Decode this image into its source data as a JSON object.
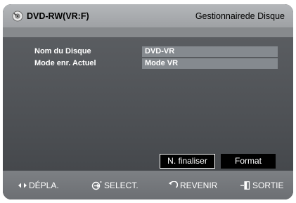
{
  "header": {
    "disc_label": "DVD-RW(VR:F)",
    "title": "Gestionnairede Disque",
    "disc_icon": "disc-icon"
  },
  "info": {
    "rows": [
      {
        "label": "Nom du Disque",
        "value": "DVD-VR"
      },
      {
        "label": "Mode enr. Actuel",
        "value": "Mode VR"
      }
    ]
  },
  "buttons": {
    "finalize_label": "N. finaliser",
    "format_label": "Format"
  },
  "footer": {
    "move": {
      "label": "DÉPLA.",
      "icon": "left-right-arrows-icon"
    },
    "select": {
      "label": "SELECT.",
      "icon": "enter-icon"
    },
    "back": {
      "label": "REVENIR",
      "icon": "return-icon"
    },
    "exit": {
      "label": "SORTIE",
      "icon": "exit-icon"
    }
  },
  "colors": {
    "header_bg": "#a9acaf",
    "content_bg": "#525559",
    "value_bg": "#858a8f",
    "footer_bg": "#75787c",
    "focus_border": "#ffffff"
  }
}
